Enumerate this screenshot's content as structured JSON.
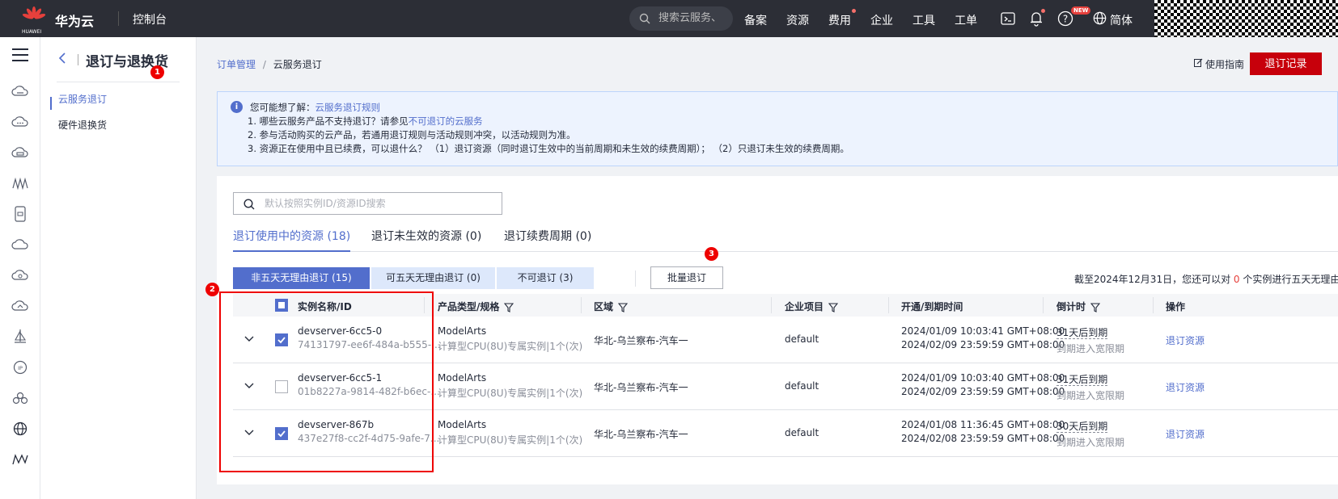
{
  "topbar": {
    "logo_text": "HUAWEI",
    "brand": "华为云",
    "console": "控制台",
    "search_placeholder": "搜索云服务、",
    "nav": [
      "备案",
      "资源",
      "费用",
      "企业",
      "工具",
      "工单"
    ],
    "new_badge": "NEW",
    "language": "简体"
  },
  "subnav": {
    "title": "退订与退换货",
    "items": [
      "云服务退订",
      "硬件退换货"
    ]
  },
  "badges": [
    "1",
    "2",
    "3"
  ],
  "breadcrumb": {
    "parent": "订单管理",
    "sep": "/",
    "current": "云服务退订"
  },
  "header": {
    "guide": "使用指南",
    "record_button": "退订记录"
  },
  "info": {
    "lead": "您可能想了解：",
    "lead_link": "云服务退订规则",
    "line1_pre": "1. 哪些云服务产品不支持退订？请参见",
    "line1_link": "不可退订的云服务",
    "line2": "2. 参与活动购买的云产品，若通用退订规则与活动规则冲突，以活动规则为准。",
    "line3": "3. 资源正在使用中且已续费，可以退什么？ （1）退订资源（同时退订生效中的当前周期和未生效的续费周期）； （2）只退订未生效的续费周期。"
  },
  "search": {
    "placeholder": "默认按照实例ID/资源ID搜索"
  },
  "tabs": [
    "退订使用中的资源 (18)",
    "退订未生效的资源 (0)",
    "退订续费周期 (0)"
  ],
  "segments": [
    "非五天无理由退订 (15)",
    "可五天无理由退订 (0)",
    "不可退订 (3)"
  ],
  "batch_button": "批量退订",
  "note": {
    "pre": "截至2024年12月31日，您还可以对 ",
    "count": "0",
    "post": " 个实例进行五天无理由全"
  },
  "table": {
    "headers": [
      "实例名称/ID",
      "产品类型/规格",
      "区域",
      "企业项目",
      "开通/到期时间",
      "倒计时",
      "操作"
    ],
    "rows": [
      {
        "name": "devserver-6cc5-0",
        "id": "74131797-ee6f-484a-b555-...",
        "product": "ModelArts",
        "spec": "计算型CPU(8U)专属实例|1个(次)",
        "region": "华北-乌兰察布-汽车一",
        "project": "default",
        "start": "2024/01/09 10:03:41 GMT+08:00",
        "end": "2024/02/09 23:59:59 GMT+08:00",
        "countdown": "31天后到期",
        "countdown_sub": "到期进入宽限期",
        "action": "退订资源",
        "checked": true
      },
      {
        "name": "devserver-6cc5-1",
        "id": "01b8227a-9814-482f-b6ec-...",
        "product": "ModelArts",
        "spec": "计算型CPU(8U)专属实例|1个(次)",
        "region": "华北-乌兰察布-汽车一",
        "project": "default",
        "start": "2024/01/09 10:03:40 GMT+08:00",
        "end": "2024/02/09 23:59:59 GMT+08:00",
        "countdown": "31天后到期",
        "countdown_sub": "到期进入宽限期",
        "action": "退订资源",
        "checked": false
      },
      {
        "name": "devserver-867b",
        "id": "437e27f8-cc2f-4d75-9afe-7...",
        "product": "ModelArts",
        "spec": "计算型CPU(8U)专属实例|1个(次)",
        "region": "华北-乌兰察布-汽车一",
        "project": "default",
        "start": "2024/01/08 11:36:45 GMT+08:00",
        "end": "2024/02/08 23:59:59 GMT+08:00",
        "countdown": "30天后到期",
        "countdown_sub": "到期进入宽限期",
        "action": "退订资源",
        "checked": true
      }
    ]
  },
  "colors": {
    "accent": "#526ecc",
    "brand_red": "#c7000b",
    "topbar": "#2c2e36",
    "annotation_red": "#e00000"
  }
}
